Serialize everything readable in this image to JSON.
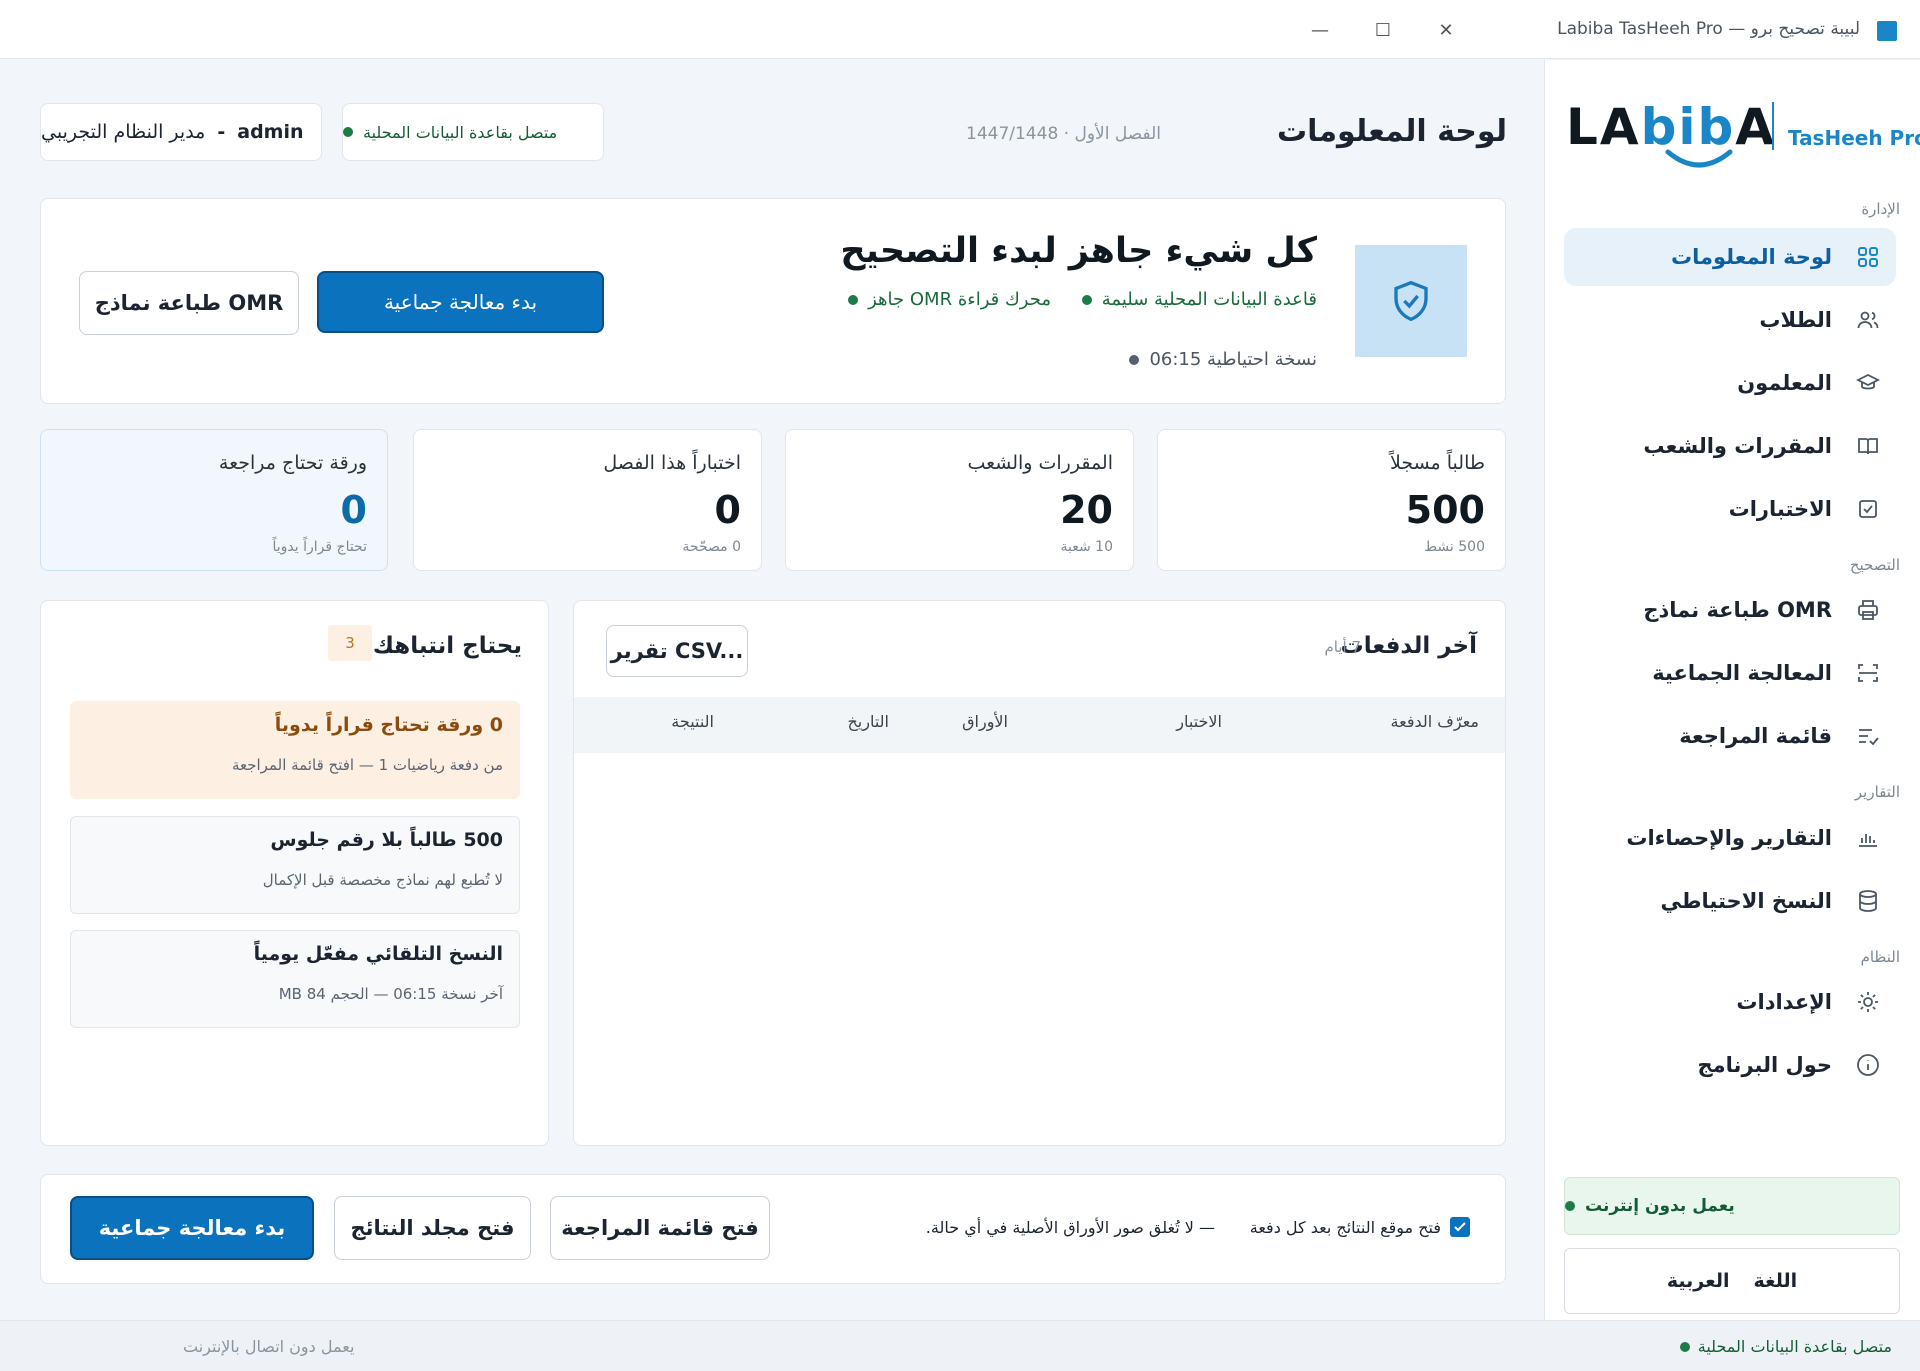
{
  "window": {
    "title": "لبيبة تصحيح برو — Labiba TasHeeh Pro",
    "minimize_glyph": "—",
    "maximize_glyph": "☐",
    "close_glyph": "✕"
  },
  "brand": {
    "logo_word_pre": "LA",
    "logo_word_b": "bib",
    "logo_word_post": "A",
    "product": "TasHeeh Pro"
  },
  "sidebar": {
    "sections": {
      "admin": "الإدارة",
      "grading": "التصحيح",
      "reports": "التقارير",
      "system": "النظام"
    },
    "items": [
      {
        "label": "لوحة المعلومات",
        "icon": "grid-icon",
        "active": true
      },
      {
        "label": "الطلاب",
        "icon": "users-icon"
      },
      {
        "label": "المعلمون",
        "icon": "graduation-cap-icon"
      },
      {
        "label": "المقررات والشعب",
        "icon": "book-icon"
      },
      {
        "label": "الاختبارات",
        "icon": "check-square-icon"
      },
      {
        "label": "طباعة نماذج OMR",
        "icon": "printer-icon"
      },
      {
        "label": "المعالجة الجماعية",
        "icon": "scan-icon"
      },
      {
        "label": "قائمة المراجعة",
        "icon": "list-check-icon"
      },
      {
        "label": "التقارير والإحصاءات",
        "icon": "bar-chart-icon"
      },
      {
        "label": "النسخ الاحتياطي",
        "icon": "database-icon"
      },
      {
        "label": "الإعدادات",
        "icon": "sun-gear-icon"
      },
      {
        "label": "حول البرنامج",
        "icon": "info-icon"
      }
    ],
    "offline_label": "يعمل بدون إنترنت",
    "language_label": "اللغة",
    "language_value": "العربية"
  },
  "header": {
    "title": "لوحة المعلومات",
    "semester": "الفصل الأول · 1447/1448",
    "db_status": "متصل بقاعدة البيانات المحلية",
    "user_role": "مدير النظام التجريبي",
    "user_sep": "-",
    "user_name": "admin"
  },
  "hero": {
    "title": "كل شيء جاهز لبدء التصحيح",
    "db_ok": "قاعدة البيانات المحلية سليمة",
    "omr_ok": "محرك قراءة OMR جاهز",
    "backup": "نسخة احتياطية 06:15",
    "batch_button": "بدء معالجة جماعية",
    "print_button": "طباعة نماذج OMR"
  },
  "stats": [
    {
      "label": "طالباً مسجلاً",
      "value": "500",
      "sub": "500 نشط"
    },
    {
      "label": "المقررات والشعب",
      "value": "20",
      "sub": "10 شعبة"
    },
    {
      "label": "اختباراً هذا الفصل",
      "value": "0",
      "sub": "0 مصحّحة"
    },
    {
      "label": "ورقة تحتاج مراجعة",
      "value": "0",
      "sub": "تحتاج قراراً يدوياً"
    }
  ],
  "batches": {
    "title": "آخر الدفعات",
    "period": "7 أيام",
    "csv_button": "تقرير CSV...",
    "columns": [
      "معرّف الدفعة",
      "الاختبار",
      "الأوراق",
      "التاريخ",
      "النتيجة"
    ],
    "rows": []
  },
  "attention": {
    "title": "يحتاج انتباهك",
    "count": "3",
    "items": [
      {
        "title": "0 ورقة تحتاج قراراً يدوياً",
        "sub": "من دفعة رياضيات 1 — افتح قائمة المراجعة"
      },
      {
        "title": "500 طالباً بلا رقم جلوس",
        "sub": "لا تُطبع لهم نماذج مخصصة قبل الإكمال"
      },
      {
        "title": "النسخ التلقائي مفعّل يومياً",
        "sub": "آخر نسخة 06:15 — الحجم 84 MB"
      }
    ]
  },
  "actions": {
    "open_results_site": "فتح موقع النتائج بعد كل دفعة",
    "note": "— لا تُغلق صور الأوراق الأصلية في أي حالة.",
    "open_review": "فتح قائمة المراجعة",
    "open_folder": "فتح مجلد النتائج",
    "batch": "بدء معالجة جماعية"
  },
  "statusbar": {
    "db": "متصل بقاعدة البيانات المحلية",
    "offline": "يعمل دون اتصال بالإنترنت"
  },
  "colors": {
    "accent": "#0b72bd",
    "success": "#1e7a46",
    "warning_bg": "#fdf0e2"
  }
}
